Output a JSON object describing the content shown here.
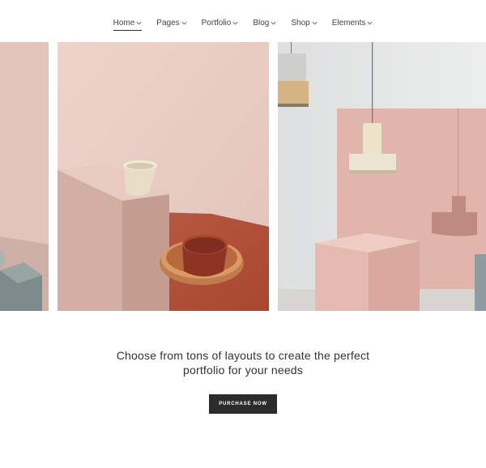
{
  "nav": {
    "items": [
      {
        "label": "Home",
        "active": true
      },
      {
        "label": "Pages"
      },
      {
        "label": "Portfolio"
      },
      {
        "label": "Blog"
      },
      {
        "label": "Shop"
      },
      {
        "label": "Elements"
      }
    ]
  },
  "gallery": {
    "images": [
      {
        "name": "pink-wall-grey-block"
      },
      {
        "name": "cup-on-pink-block-with-terracotta-bowls"
      },
      {
        "name": "pendant-lamps-pink-cube"
      }
    ]
  },
  "hero": {
    "line1": "Choose from tons of layouts to create the perfect",
    "line2": "portfolio for your needs"
  },
  "cta": {
    "label": "PURCHASE NOW"
  },
  "colors": {
    "accent_dark": "#2c2c2c",
    "pink_wall": "#e9cfc6",
    "terracotta": "#b4533f"
  }
}
